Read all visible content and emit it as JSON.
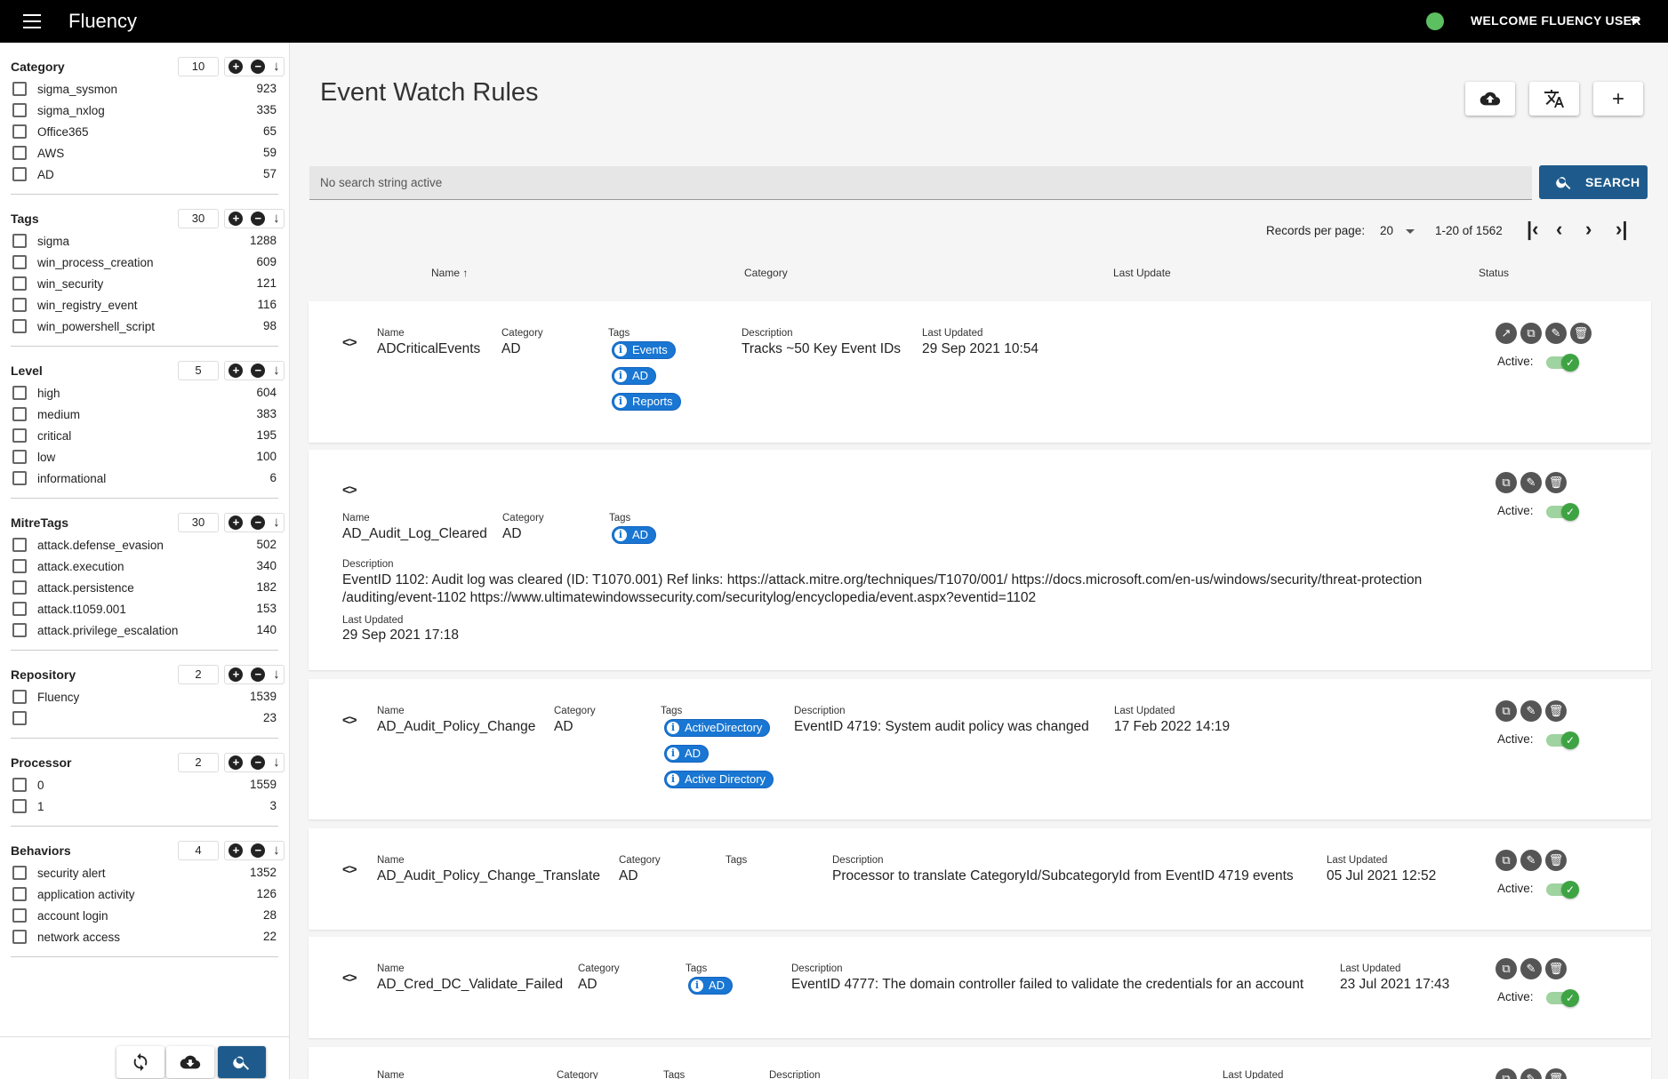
{
  "app": {
    "title": "Fluency",
    "welcome": "WELCOME FLUENCY USER"
  },
  "facets": [
    {
      "title": "Category",
      "count": "10",
      "items": [
        {
          "label": "sigma_sysmon",
          "value": "923"
        },
        {
          "label": "sigma_nxlog",
          "value": "335"
        },
        {
          "label": "Office365",
          "value": "65"
        },
        {
          "label": "AWS",
          "value": "59"
        },
        {
          "label": "AD",
          "value": "57"
        }
      ]
    },
    {
      "title": "Tags",
      "count": "30",
      "items": [
        {
          "label": "sigma",
          "value": "1288"
        },
        {
          "label": "win_process_creation",
          "value": "609"
        },
        {
          "label": "win_security",
          "value": "121"
        },
        {
          "label": "win_registry_event",
          "value": "116"
        },
        {
          "label": "win_powershell_script",
          "value": "98"
        }
      ]
    },
    {
      "title": "Level",
      "count": "5",
      "items": [
        {
          "label": "high",
          "value": "604"
        },
        {
          "label": "medium",
          "value": "383"
        },
        {
          "label": "critical",
          "value": "195"
        },
        {
          "label": "low",
          "value": "100"
        },
        {
          "label": "informational",
          "value": "6"
        }
      ]
    },
    {
      "title": "MitreTags",
      "count": "30",
      "items": [
        {
          "label": "attack.defense_evasion",
          "value": "502"
        },
        {
          "label": "attack.execution",
          "value": "340"
        },
        {
          "label": "attack.persistence",
          "value": "182"
        },
        {
          "label": "attack.t1059.001",
          "value": "153"
        },
        {
          "label": "attack.privilege_escalation",
          "value": "140"
        }
      ]
    },
    {
      "title": "Repository",
      "count": "2",
      "items": [
        {
          "label": "Fluency",
          "value": "1539"
        },
        {
          "label": "",
          "value": "23"
        }
      ]
    },
    {
      "title": "Processor",
      "count": "2",
      "items": [
        {
          "label": "0",
          "value": "1559"
        },
        {
          "label": "1",
          "value": "3"
        }
      ]
    },
    {
      "title": "Behaviors",
      "count": "4",
      "items": [
        {
          "label": "security alert",
          "value": "1352"
        },
        {
          "label": "application activity",
          "value": "126"
        },
        {
          "label": "account login",
          "value": "28"
        },
        {
          "label": "network access",
          "value": "22"
        }
      ]
    }
  ],
  "page": {
    "title": "Event Watch Rules"
  },
  "search": {
    "placeholder": "No search string active",
    "button": "SEARCH"
  },
  "pager": {
    "label": "Records per page:",
    "per_page": "20",
    "range": "1-20 of 1562"
  },
  "columns": {
    "name": "Name",
    "category": "Category",
    "last_update": "Last Update",
    "status": "Status"
  },
  "labels": {
    "name": "Name",
    "category": "Category",
    "tags": "Tags",
    "description": "Description",
    "last_updated": "Last Updated",
    "active": "Active:"
  },
  "rules": [
    {
      "name": "ADCriticalEvents",
      "category": "AD",
      "tags": [
        "Events",
        "AD",
        "Reports"
      ],
      "description": "Tracks ~50 Key Event IDs",
      "last_updated": "29 Sep 2021 10:54"
    },
    {
      "name": "AD_Audit_Log_Cleared",
      "category": "AD",
      "tags": [
        "AD"
      ],
      "description_line1": "EventID 1102: Audit log was cleared (ID: T1070.001) Ref links: https://attack.mitre.org/techniques/T1070/001/ https://docs.microsoft.com/en-us/windows/security/threat-protection",
      "description_line2": "/auditing/event-1102 https://www.ultimatewindowssecurity.com/securitylog/encyclopedia/event.aspx?eventid=1102",
      "last_updated": "29 Sep 2021 17:18"
    },
    {
      "name": "AD_Audit_Policy_Change",
      "category": "AD",
      "tags": [
        "ActiveDirectory",
        "AD",
        "Active Directory"
      ],
      "description": "EventID 4719: System audit policy was changed",
      "last_updated": "17 Feb 2022 14:19"
    },
    {
      "name": "AD_Audit_Policy_Change_Translate",
      "category": "AD",
      "tags": [],
      "description": "Processor to translate CategoryId/SubcategoryId from EventID 4719 events",
      "last_updated": "05 Jul 2021 12:52"
    },
    {
      "name": "AD_Cred_DC_Validate_Failed",
      "category": "AD",
      "tags": [
        "AD"
      ],
      "description": "EventID 4777: The domain controller failed to validate the credentials for an account",
      "last_updated": "23 Jul 2021 17:43"
    }
  ],
  "icons": {
    "menu": "hamburger-icon",
    "upload": "cloud-upload-icon",
    "translate": "translate-icon",
    "add": "plus-icon",
    "search": "search-icon",
    "refresh": "refresh-icon",
    "code": "code-icon",
    "chart": "chart-icon",
    "copy": "copy-icon",
    "edit": "edit-icon",
    "delete": "delete-icon",
    "check": "check-icon"
  },
  "colors": {
    "primary": "#1e5b8c",
    "tag": "#1976d2",
    "toggle": "#3ea343",
    "status": "#5cbf60"
  }
}
